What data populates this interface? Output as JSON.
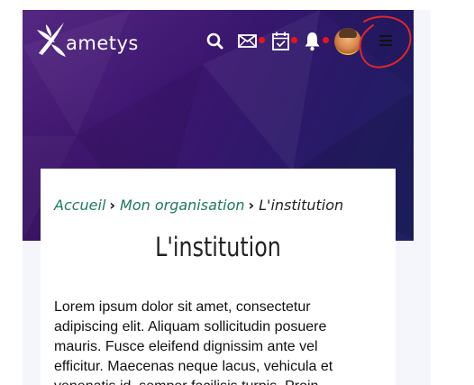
{
  "header": {
    "logo_text": "ametys",
    "icons": [
      "search-icon",
      "mail-icon",
      "calendar-icon",
      "bell-icon"
    ],
    "notification_color": "#e8141d"
  },
  "breadcrumb": {
    "items": [
      "Accueil",
      "Mon organisation"
    ],
    "current": "L'institution"
  },
  "page": {
    "title": "L'institution",
    "body": "Lorem ipsum dolor sit amet, consectetur adipiscing elit. Aliquam sollicitudin posuere mauris. Fusce eleifend dignissim ante vel efficitur. Maecenas neque lacus, vehicula et venenatis id, semper facilisis turpis. Proin"
  },
  "colors": {
    "hero_purple": "#3c1670",
    "link_green": "#1e7b59",
    "annotation_red": "#e0262a"
  }
}
